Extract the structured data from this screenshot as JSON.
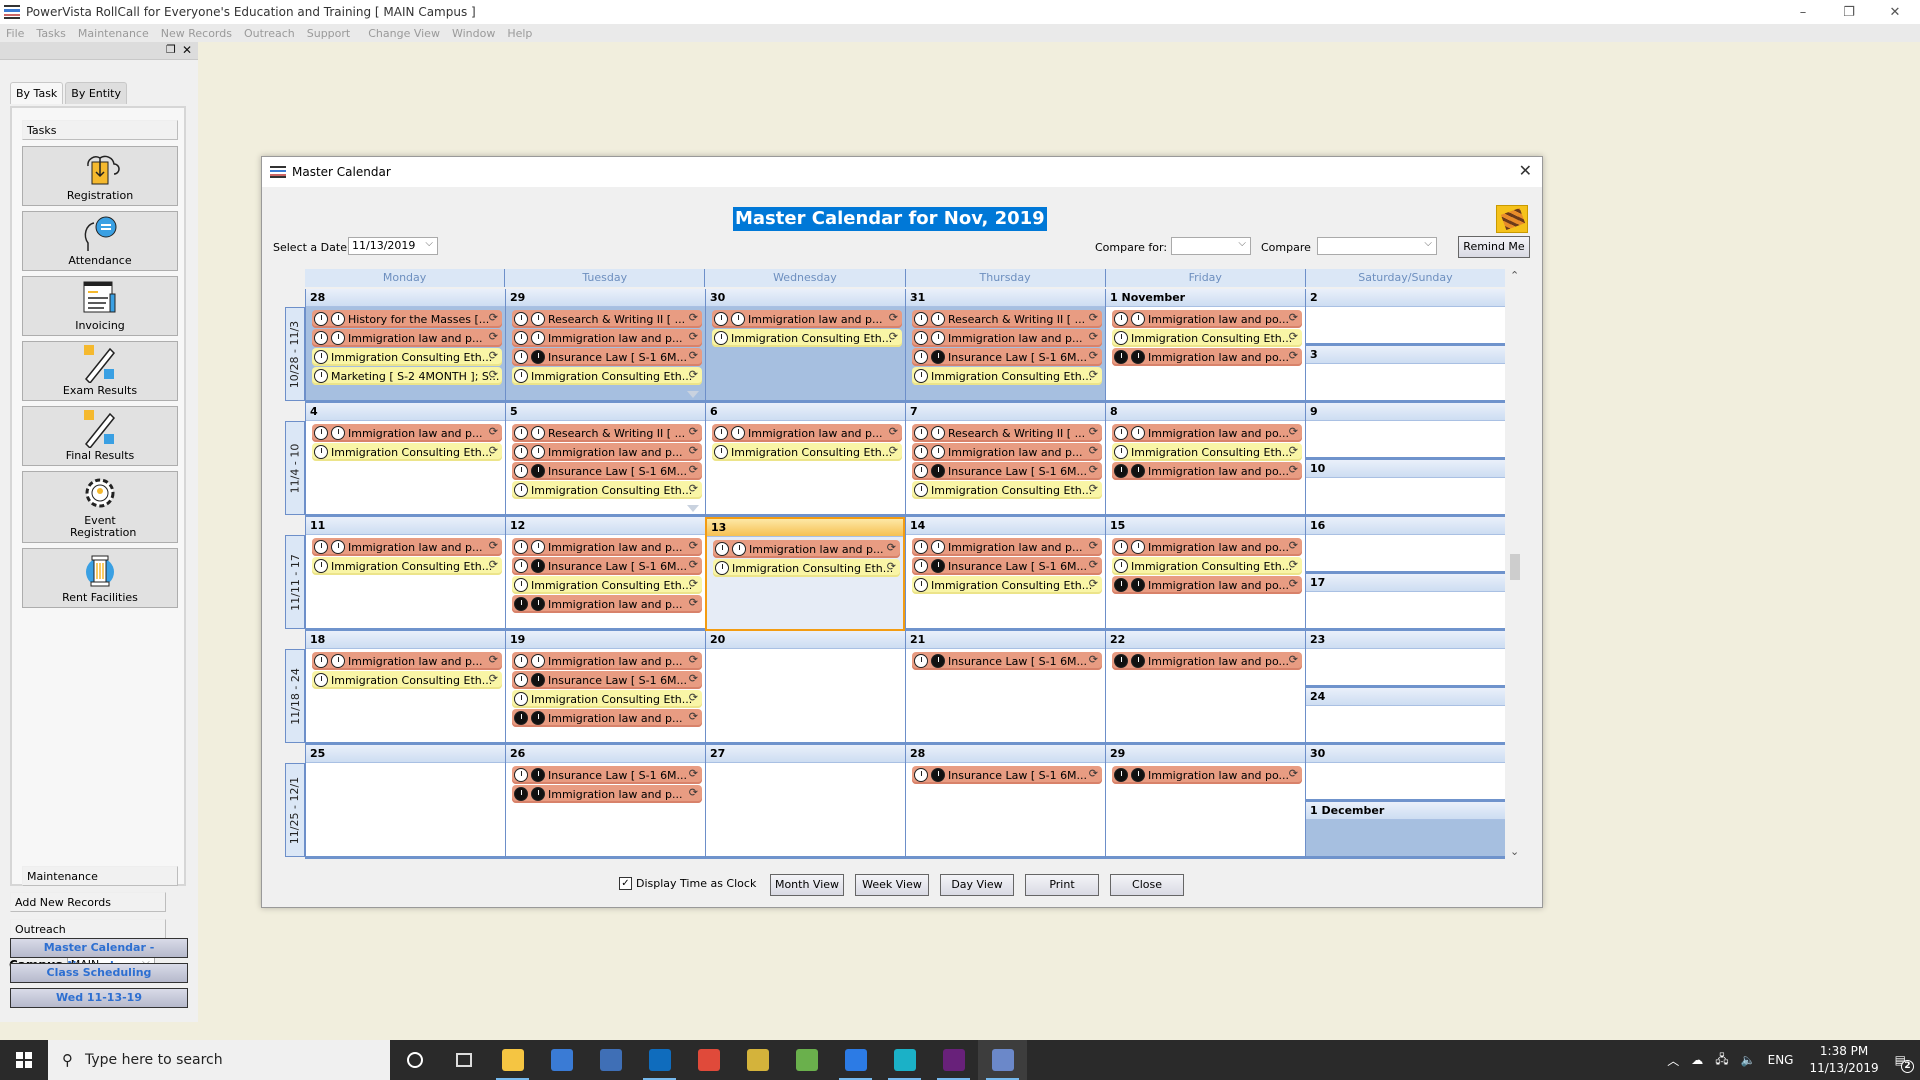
{
  "app": {
    "title": "PowerVista RollCall for Everyone's Education and Training    [ MAIN Campus ]",
    "window_controls": {
      "minimize": "–",
      "restore": "❐",
      "close": "✕"
    }
  },
  "menu": [
    "File",
    "Tasks",
    "Maintenance",
    "New Records",
    "Outreach",
    "Support",
    "Change View",
    "Window",
    "Help"
  ],
  "sidebar": {
    "pin_icon": "restore-icon",
    "close_icon": "✕",
    "tabs": [
      {
        "label": "By Task",
        "active": true
      },
      {
        "label": "By Entity",
        "active": false
      }
    ],
    "tasks_header": "Tasks",
    "tasks": [
      {
        "label": "Registration",
        "icon": "registration-book-icon"
      },
      {
        "label": "Attendance",
        "icon": "attendance-head-icon"
      },
      {
        "label": "Invoicing",
        "icon": "invoice-document-icon"
      },
      {
        "label": "Exam Results",
        "icon": "exam-pencil-icon"
      },
      {
        "label": "Final Results",
        "icon": "final-pencil-icon"
      },
      {
        "label": "Event Registration",
        "icon": "event-gear-icon"
      },
      {
        "label": "Rent Facilities",
        "icon": "column-pillar-icon"
      }
    ],
    "nav_sections": [
      "Maintenance",
      "Add New Records",
      "Outreach"
    ],
    "campus_label": "Campus",
    "campus_value": "MAIN",
    "quick_links": [
      "Master Calendar - November",
      "Class Scheduling",
      "Wed 11-13-19"
    ]
  },
  "dialog": {
    "title": "Master Calendar",
    "heading": "Master Calendar for Nov, 2019",
    "select_date_label": "Select a Date",
    "select_date_value": "11/13/2019",
    "compare_for_label": "Compare for:",
    "compare_for_value": "",
    "compare_label": "Compare",
    "compare_value": "",
    "remind_me": "Remind Me",
    "display_time_as_clock_label": "Display Time as Clock",
    "display_time_as_clock_checked": true,
    "buttons": [
      "Month View",
      "Week View",
      "Day View",
      "Print",
      "Close"
    ]
  },
  "calendar": {
    "day_headers": [
      "Monday",
      "Tuesday",
      "Wednesday",
      "Thursday",
      "Friday",
      "Saturday/Sunday"
    ],
    "today": "13",
    "weeks": [
      {
        "label": "10/28 - 11/3",
        "days": [
          {
            "date": "28",
            "shaded": true,
            "events": [
              {
                "title": "History for the Masses [...",
                "color": "orange",
                "clocks": [
                  "light",
                  "light"
                ]
              },
              {
                "title": "Immigration law and p...",
                "color": "orange",
                "clocks": [
                  "light",
                  "light"
                ]
              },
              {
                "title": "Immigration Consulting Eth...",
                "color": "yellow",
                "clocks": [
                  "light"
                ]
              },
              {
                "title": "Marketing [ S-2 4MONTH ]; S...",
                "color": "yellow",
                "clocks": [
                  "light"
                ]
              }
            ]
          },
          {
            "date": "29",
            "shaded": true,
            "more": true,
            "events": [
              {
                "title": "Research & Writing II [ ...",
                "color": "orange",
                "clocks": [
                  "light",
                  "light"
                ]
              },
              {
                "title": "Immigration law and p...",
                "color": "orange",
                "clocks": [
                  "light",
                  "light"
                ]
              },
              {
                "title": "Insurance Law [ S-1 6M...",
                "color": "orange",
                "clocks": [
                  "light",
                  "dark"
                ]
              },
              {
                "title": "Immigration Consulting Eth...",
                "color": "yellow",
                "clocks": [
                  "light"
                ]
              }
            ]
          },
          {
            "date": "30",
            "shaded": true,
            "events": [
              {
                "title": "Immigration law and p...",
                "color": "orange",
                "clocks": [
                  "light",
                  "light"
                ]
              },
              {
                "title": "Immigration Consulting Eth...",
                "color": "yellow",
                "clocks": [
                  "light"
                ]
              }
            ]
          },
          {
            "date": "31",
            "shaded": true,
            "events": [
              {
                "title": "Research & Writing II [ ...",
                "color": "orange",
                "clocks": [
                  "light",
                  "light"
                ]
              },
              {
                "title": "Immigration law and p...",
                "color": "orange",
                "clocks": [
                  "light",
                  "light"
                ]
              },
              {
                "title": "Insurance Law [ S-1 6M...",
                "color": "orange",
                "clocks": [
                  "light",
                  "dark"
                ]
              },
              {
                "title": "Immigration Consulting Eth...",
                "color": "yellow",
                "clocks": [
                  "light"
                ]
              }
            ]
          },
          {
            "date": "1 November",
            "events": [
              {
                "title": "Immigration law and po...",
                "color": "orange",
                "clocks": [
                  "light",
                  "light"
                ]
              },
              {
                "title": "Immigration Consulting Eth...",
                "color": "yellow",
                "clocks": [
                  "light"
                ]
              },
              {
                "title": "Immigration law and po...",
                "color": "orange",
                "clocks": [
                  "dark",
                  "dark"
                ]
              }
            ]
          },
          {
            "weekend": [
              {
                "date": "2",
                "events": []
              },
              {
                "date": "3",
                "events": []
              }
            ]
          }
        ]
      },
      {
        "label": "11/4 - 10",
        "days": [
          {
            "date": "4",
            "events": [
              {
                "title": "Immigration law and p...",
                "color": "orange",
                "clocks": [
                  "light",
                  "light"
                ]
              },
              {
                "title": "Immigration Consulting Eth...",
                "color": "yellow",
                "clocks": [
                  "light"
                ]
              }
            ]
          },
          {
            "date": "5",
            "more": true,
            "events": [
              {
                "title": "Research & Writing II [ ...",
                "color": "orange",
                "clocks": [
                  "light",
                  "light"
                ]
              },
              {
                "title": "Immigration law and p...",
                "color": "orange",
                "clocks": [
                  "light",
                  "light"
                ]
              },
              {
                "title": "Insurance Law [ S-1 6M...",
                "color": "orange",
                "clocks": [
                  "light",
                  "dark"
                ]
              },
              {
                "title": "Immigration Consulting Eth...",
                "color": "yellow",
                "clocks": [
                  "light"
                ]
              }
            ]
          },
          {
            "date": "6",
            "events": [
              {
                "title": "Immigration law and p...",
                "color": "orange",
                "clocks": [
                  "light",
                  "light"
                ]
              },
              {
                "title": "Immigration Consulting Eth...",
                "color": "yellow",
                "clocks": [
                  "light"
                ]
              }
            ]
          },
          {
            "date": "7",
            "events": [
              {
                "title": "Research & Writing II [ ...",
                "color": "orange",
                "clocks": [
                  "light",
                  "light"
                ]
              },
              {
                "title": "Immigration law and p...",
                "color": "orange",
                "clocks": [
                  "light",
                  "light"
                ]
              },
              {
                "title": "Insurance Law [ S-1 6M...",
                "color": "orange",
                "clocks": [
                  "light",
                  "dark"
                ]
              },
              {
                "title": "Immigration Consulting Eth...",
                "color": "yellow",
                "clocks": [
                  "light"
                ]
              }
            ]
          },
          {
            "date": "8",
            "events": [
              {
                "title": "Immigration law and po...",
                "color": "orange",
                "clocks": [
                  "light",
                  "light"
                ]
              },
              {
                "title": "Immigration Consulting Eth...",
                "color": "yellow",
                "clocks": [
                  "light"
                ]
              },
              {
                "title": "Immigration law and po...",
                "color": "orange",
                "clocks": [
                  "dark",
                  "dark"
                ]
              }
            ]
          },
          {
            "weekend": [
              {
                "date": "9",
                "events": []
              },
              {
                "date": "10",
                "events": []
              }
            ]
          }
        ]
      },
      {
        "label": "11/11 - 17",
        "days": [
          {
            "date": "11",
            "events": [
              {
                "title": "Immigration law and p...",
                "color": "orange",
                "clocks": [
                  "light",
                  "light"
                ]
              },
              {
                "title": "Immigration Consulting Eth...",
                "color": "yellow",
                "clocks": [
                  "light"
                ]
              }
            ]
          },
          {
            "date": "12",
            "events": [
              {
                "title": "Immigration law and p...",
                "color": "orange",
                "clocks": [
                  "light",
                  "light"
                ]
              },
              {
                "title": "Insurance Law [ S-1 6M...",
                "color": "orange",
                "clocks": [
                  "light",
                  "dark"
                ]
              },
              {
                "title": "Immigration Consulting Eth...",
                "color": "yellow",
                "clocks": [
                  "light"
                ]
              },
              {
                "title": "Immigration law and p...",
                "color": "orange",
                "clocks": [
                  "dark",
                  "dark"
                ]
              }
            ]
          },
          {
            "date": "13",
            "today": true,
            "events": [
              {
                "title": "Immigration law and p...",
                "color": "orange",
                "clocks": [
                  "light",
                  "light"
                ]
              },
              {
                "title": "Immigration Consulting Eth...",
                "color": "yellow",
                "clocks": [
                  "light"
                ]
              }
            ]
          },
          {
            "date": "14",
            "events": [
              {
                "title": "Immigration law and p...",
                "color": "orange",
                "clocks": [
                  "light",
                  "light"
                ]
              },
              {
                "title": "Insurance Law [ S-1 6M...",
                "color": "orange",
                "clocks": [
                  "light",
                  "dark"
                ]
              },
              {
                "title": "Immigration Consulting Eth...",
                "color": "yellow",
                "clocks": [
                  "light"
                ]
              }
            ]
          },
          {
            "date": "15",
            "events": [
              {
                "title": "Immigration law and po...",
                "color": "orange",
                "clocks": [
                  "light",
                  "light"
                ]
              },
              {
                "title": "Immigration Consulting Eth...",
                "color": "yellow",
                "clocks": [
                  "light"
                ]
              },
              {
                "title": "Immigration law and po...",
                "color": "orange",
                "clocks": [
                  "dark",
                  "dark"
                ]
              }
            ]
          },
          {
            "weekend": [
              {
                "date": "16",
                "events": []
              },
              {
                "date": "17",
                "events": []
              }
            ]
          }
        ]
      },
      {
        "label": "11/18 - 24",
        "days": [
          {
            "date": "18",
            "events": [
              {
                "title": "Immigration law and p...",
                "color": "orange",
                "clocks": [
                  "light",
                  "light"
                ]
              },
              {
                "title": "Immigration Consulting Eth...",
                "color": "yellow",
                "clocks": [
                  "light"
                ]
              }
            ]
          },
          {
            "date": "19",
            "events": [
              {
                "title": "Immigration law and p...",
                "color": "orange",
                "clocks": [
                  "light",
                  "light"
                ]
              },
              {
                "title": "Insurance Law [ S-1 6M...",
                "color": "orange",
                "clocks": [
                  "light",
                  "dark"
                ]
              },
              {
                "title": "Immigration Consulting Eth...",
                "color": "yellow",
                "clocks": [
                  "light"
                ]
              },
              {
                "title": "Immigration law and p...",
                "color": "orange",
                "clocks": [
                  "dark",
                  "dark"
                ]
              }
            ]
          },
          {
            "date": "20",
            "events": []
          },
          {
            "date": "21",
            "events": [
              {
                "title": "Insurance Law [ S-1 6M...",
                "color": "orange",
                "clocks": [
                  "light",
                  "dark"
                ]
              }
            ]
          },
          {
            "date": "22",
            "events": [
              {
                "title": "Immigration law and po...",
                "color": "orange",
                "clocks": [
                  "dark",
                  "dark"
                ]
              }
            ]
          },
          {
            "weekend": [
              {
                "date": "23",
                "events": []
              },
              {
                "date": "24",
                "events": []
              }
            ]
          }
        ]
      },
      {
        "label": "11/25 - 12/1",
        "days": [
          {
            "date": "25",
            "events": []
          },
          {
            "date": "26",
            "events": [
              {
                "title": "Insurance Law [ S-1 6M...",
                "color": "orange",
                "clocks": [
                  "light",
                  "dark"
                ]
              },
              {
                "title": "Immigration law and p...",
                "color": "orange",
                "clocks": [
                  "dark",
                  "dark"
                ]
              }
            ]
          },
          {
            "date": "27",
            "events": []
          },
          {
            "date": "28",
            "events": [
              {
                "title": "Insurance Law [ S-1 6M...",
                "color": "orange",
                "clocks": [
                  "light",
                  "dark"
                ]
              }
            ]
          },
          {
            "date": "29",
            "events": [
              {
                "title": "Immigration law and po...",
                "color": "orange",
                "clocks": [
                  "dark",
                  "dark"
                ]
              }
            ]
          },
          {
            "weekend": [
              {
                "date": "30",
                "events": []
              },
              {
                "date": "1 December",
                "shaded": true,
                "events": []
              }
            ]
          }
        ]
      }
    ]
  },
  "taskbar": {
    "search_placeholder": "Type here to search",
    "apps": [
      "cortana-icon",
      "task-view-icon",
      "file-explorer-icon",
      "app-icon",
      "app-icon",
      "outlook-icon",
      "chrome-icon",
      "tools-icon",
      "app-icon",
      "vscode-icon",
      "app-icon",
      "visual-studio-icon",
      "powervista-icon"
    ],
    "language": "ENG",
    "time": "1:38 PM",
    "date": "11/13/2019",
    "notifications": "2"
  }
}
